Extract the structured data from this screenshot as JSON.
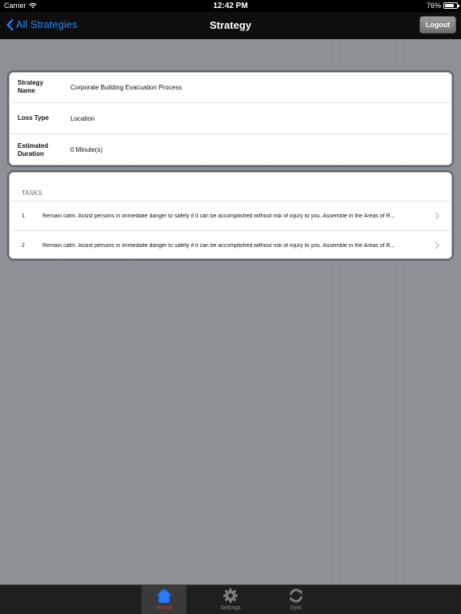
{
  "status_bar": {
    "carrier": "Carrier",
    "time": "12:42 PM",
    "battery": "76%",
    "battery_level": 0.76
  },
  "nav": {
    "back_label": "All Strategies",
    "title": "Strategy",
    "logout_label": "Logout"
  },
  "details": [
    {
      "label": "Strategy Name",
      "value": "Corporate Building Evacuation Process"
    },
    {
      "label": "Loss Type",
      "value": "Location"
    },
    {
      "label": "Estimated Duration",
      "value": "0 Minute(s)"
    }
  ],
  "tasks": {
    "header": "TASKS",
    "items": [
      {
        "num": "1",
        "text": "Remain calm. Assist persons in immediate danger to safety if it can be accomplished without risk of injury to you. Assemble in the Areas of R..."
      },
      {
        "num": "2",
        "text": "Remain calm. Assist persons in immediate danger to safety if it can be accomplished without risk of injury to you. Assemble in the Areas of R..."
      }
    ]
  },
  "tab_bar": {
    "tabs": [
      {
        "label": "Home",
        "icon": "home-icon"
      },
      {
        "label": "Settings",
        "icon": "gear-icon"
      },
      {
        "label": "Sync",
        "icon": "sync-icon"
      }
    ]
  },
  "colors": {
    "accent": "#1e88ff",
    "active_tab_label": "#d9342b"
  }
}
